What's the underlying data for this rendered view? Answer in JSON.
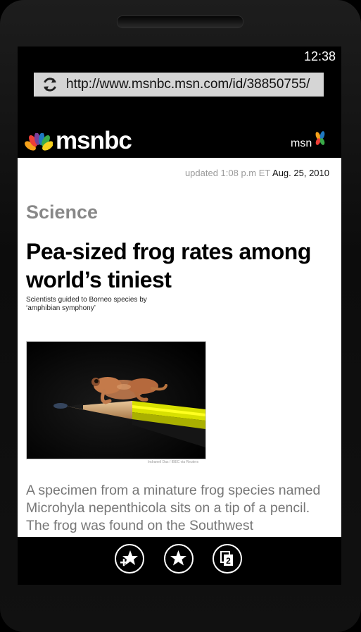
{
  "status_bar": {
    "time": "12:38"
  },
  "browser": {
    "url": "http://www.msnbc.msn.com/id/38850755/",
    "refresh_icon": "refresh-icon"
  },
  "site_header": {
    "brand": "msnbc",
    "partner": "msn",
    "peacock_colors": [
      "#f6a11a",
      "#ef3e36",
      "#7c3f98",
      "#1f78c1",
      "#3aaa49",
      "#f7d11e"
    ]
  },
  "article": {
    "updated_prefix": "updated 1:08 p.m ET",
    "updated_date": "Aug. 25, 2010",
    "section": "Science",
    "headline": "Pea-sized frog rates among world’s tiniest",
    "subheadline": "Scientists guided to Borneo species by ‘amphibian symphony’",
    "photo_credit": "Indraneil Das / IBEC via Reuters",
    "caption": "A specimen from a minature frog species named Microhyla nepenthicola sits on a tip of a pencil. The frog was found on the Southwest"
  },
  "app_bar": {
    "buttons": [
      {
        "icon": "add-favorite-icon"
      },
      {
        "icon": "favorites-icon"
      },
      {
        "icon": "tabs-icon",
        "badge": "2"
      }
    ]
  }
}
